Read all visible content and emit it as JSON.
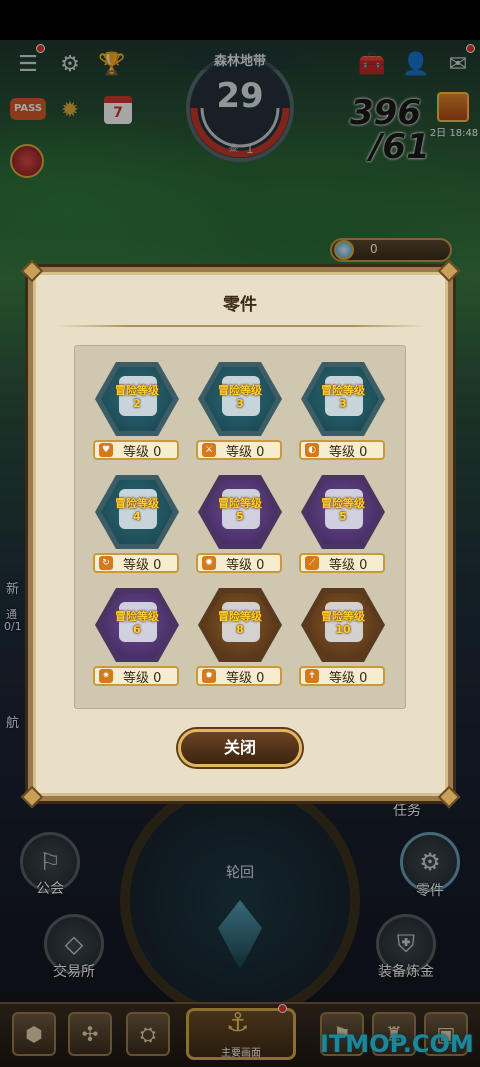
{
  "hud": {
    "zone_title": "森林地带",
    "zone_number": "29",
    "zone_sub": "1",
    "counter_line1": "396",
    "counter_line2": "/61",
    "gift_time": "2日 18:48",
    "coin_value": "0",
    "left_icons": [
      "menu-icon",
      "gear-icon",
      "trophy-icon"
    ],
    "right_icons": [
      "toolbox-icon",
      "friends-icon",
      "mail-icon"
    ],
    "row2_icons": [
      "PASS",
      "compass-icon",
      "7"
    ]
  },
  "modal": {
    "title": "零件",
    "close_label": "关闭",
    "parts": [
      {
        "label_line1": "冒险等级",
        "label_line2": "2",
        "color": "blue",
        "level_text": "等级 0",
        "icon": "heart-icon"
      },
      {
        "label_line1": "冒险等级",
        "label_line2": "3",
        "color": "blue",
        "level_text": "等级 0",
        "icon": "sword-icon"
      },
      {
        "label_line1": "冒险等级",
        "label_line2": "3",
        "color": "blue",
        "level_text": "等级 0",
        "icon": "shield-icon"
      },
      {
        "label_line1": "冒险等级",
        "label_line2": "4",
        "color": "blue",
        "level_text": "等级 0",
        "icon": "swirl-icon"
      },
      {
        "label_line1": "冒险等级",
        "label_line2": "5",
        "color": "purple",
        "level_text": "等级 0",
        "icon": "burst-icon"
      },
      {
        "label_line1": "冒险等级",
        "label_line2": "5",
        "color": "purple",
        "level_text": "等级 0",
        "icon": "blade-icon"
      },
      {
        "label_line1": "冒险等级",
        "label_line2": "6",
        "color": "purple",
        "level_text": "等级 0",
        "icon": "spark-icon"
      },
      {
        "label_line1": "冒险等级",
        "label_line2": "8",
        "color": "bronze",
        "level_text": "等级 0",
        "icon": "star-burst-icon"
      },
      {
        "label_line1": "冒险等级",
        "label_line2": "10",
        "color": "bronze",
        "level_text": "等级 0",
        "icon": "dagger-icon"
      }
    ]
  },
  "bottom": {
    "ring_label": "轮回",
    "guild_label": "公会",
    "parts_label": "零件",
    "trade_label": "交易所",
    "refine_label": "装备炼金",
    "task_label": "任务",
    "main_label": "主要画面",
    "left_text_1": "新",
    "left_text_2": "通",
    "left_text_3": "0/1",
    "left_text_4": "航",
    "watermark": "ITMOP.COM"
  },
  "colors": {
    "accent_gold": "#e2b65a",
    "level_yellow": "#ffcf2e",
    "panel": "#e9dfc6"
  }
}
